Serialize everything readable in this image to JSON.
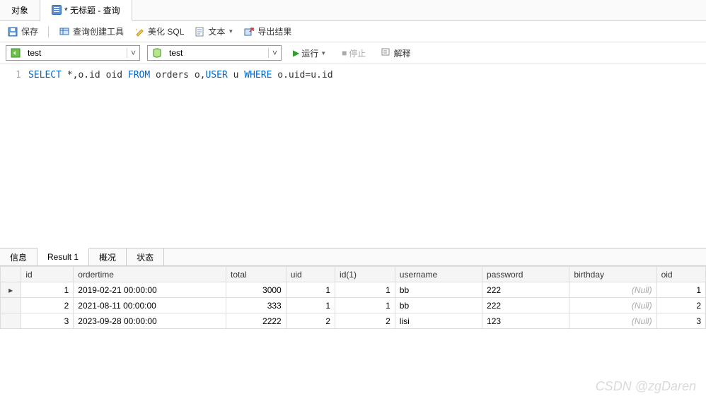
{
  "tabs": {
    "object": "对象",
    "query_title": "* 无标题 - 查询"
  },
  "toolbar": {
    "save": "保存",
    "query_builder": "查询创建工具",
    "beautify": "美化 SQL",
    "text": "文本",
    "export": "导出结果"
  },
  "combos": {
    "left": "test",
    "right": "test"
  },
  "actions": {
    "run": "运行",
    "stop": "停止",
    "explain": "解释"
  },
  "sql": {
    "line": "1",
    "t1": "SELECT",
    "t2": " *,o.id oid ",
    "t3": "FROM",
    "t4": " orders o,",
    "t5": "USER",
    "t6": " u ",
    "t7": "WHERE",
    "t8": " o.uid=u.id"
  },
  "resultTabs": {
    "info": "信息",
    "result1": "Result 1",
    "brief": "概况",
    "status": "状态"
  },
  "headers": [
    "id",
    "ordertime",
    "total",
    "uid",
    "id(1)",
    "username",
    "password",
    "birthday",
    "oid"
  ],
  "rows": [
    {
      "id": "1",
      "ordertime": "2019-02-21 00:00:00",
      "total": "3000",
      "uid": "1",
      "id1": "1",
      "username": "bb",
      "password": "222",
      "birthday": "(Null)",
      "oid": "1"
    },
    {
      "id": "2",
      "ordertime": "2021-08-11 00:00:00",
      "total": "333",
      "uid": "1",
      "id1": "1",
      "username": "bb",
      "password": "222",
      "birthday": "(Null)",
      "oid": "2"
    },
    {
      "id": "3",
      "ordertime": "2023-09-28 00:00:00",
      "total": "2222",
      "uid": "2",
      "id1": "2",
      "username": "lisi",
      "password": "123",
      "birthday": "(Null)",
      "oid": "3"
    }
  ],
  "watermark": "CSDN @zgDaren"
}
